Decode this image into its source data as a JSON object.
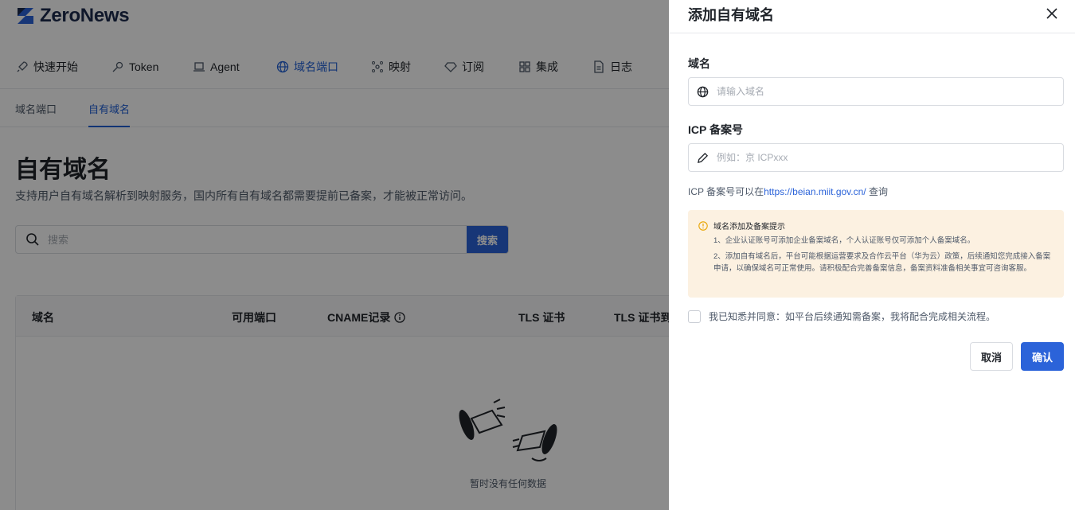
{
  "app": {
    "logo_text": "ZeroNews"
  },
  "topnav": {
    "items": [
      {
        "label": "快速开始",
        "icon": "rocket-icon"
      },
      {
        "label": "Token",
        "icon": "key-icon"
      },
      {
        "label": "Agent",
        "icon": "laptop-icon"
      },
      {
        "label": "域名端口",
        "icon": "globe-icon",
        "active": true
      },
      {
        "label": "映射",
        "icon": "network-icon"
      },
      {
        "label": "订阅",
        "icon": "diamond-icon"
      },
      {
        "label": "集成",
        "icon": "grid-icon"
      },
      {
        "label": "日志",
        "icon": "document-icon"
      }
    ]
  },
  "subtabs": {
    "items": [
      {
        "label": "域名端口"
      },
      {
        "label": "自有域名",
        "active": true
      }
    ]
  },
  "page": {
    "title": "自有域名",
    "description": "支持用户自有域名解析到映射服务，国内所有自有域名都需要提前已备案，才能被正常访问。"
  },
  "search": {
    "placeholder": "搜索",
    "button_label": "搜索"
  },
  "table": {
    "columns": [
      "域名",
      "可用端口",
      "CNAME记录",
      "TLS 证书",
      "TLS 证书到"
    ],
    "empty_text": "暂时没有任何数据"
  },
  "drawer": {
    "title": "添加自有域名",
    "domain_label": "域名",
    "domain_placeholder": "请输入域名",
    "icp_label": "ICP 备案号",
    "icp_placeholder": "例如：京 ICPxxx",
    "hint_prefix": "ICP 备案号可以在",
    "hint_link": "https://beian.miit.gov.cn/",
    "hint_suffix": " 查询",
    "notice": {
      "title": "域名添加及备案提示",
      "line1": "1、企业认证账号可添加企业备案域名，个人认证账号仅可添加个人备案域名。",
      "line2": "2、添加自有域名后，平台可能根据运营要求及合作云平台（华为云）政策，后续通知您完成接入备案申请，以确保域名可正常使用。请积极配合完善备案信息，备案资料准备相关事宜可咨询客服。"
    },
    "agree_text": "我已知悉并同意：如平台后续通知需备案，我将配合完成相关流程。",
    "cancel_label": "取消",
    "confirm_label": "确认"
  },
  "colors": {
    "accent": "#2b63d9",
    "notice_bg": "#fcf1e1",
    "overlay": "rgba(0,0,0,0.45)"
  }
}
